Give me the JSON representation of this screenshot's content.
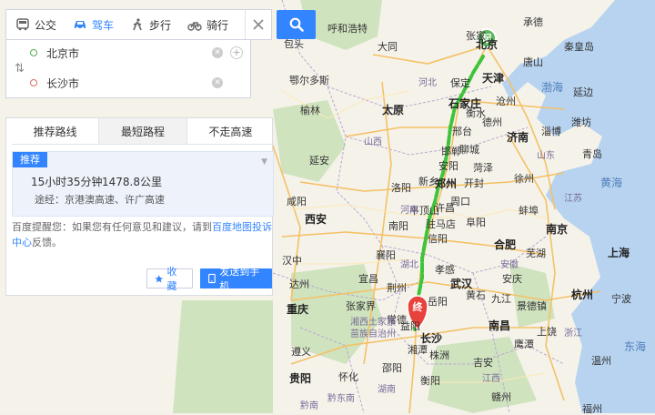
{
  "mode_tabs": [
    {
      "label": "公交",
      "icon": "bus-icon"
    },
    {
      "label": "驾车",
      "icon": "car-icon"
    },
    {
      "label": "步行",
      "icon": "walk-icon"
    },
    {
      "label": "骑行",
      "icon": "bike-icon"
    }
  ],
  "active_mode": "驾车",
  "route": {
    "origin": "北京市",
    "destination": "长沙市"
  },
  "strategy_tabs": [
    "推荐路线",
    "最短路程",
    "不走高速"
  ],
  "active_strategy": "最短路程",
  "plan": {
    "badge": "推荐",
    "duration": "15小时35分钟",
    "distance": "1478.8公里",
    "via": "途经：京港澳高速、许广高速"
  },
  "tip": {
    "prefix": "百度提醒您：如果您有任何意见和建议，请到",
    "link": "百度地图投诉中心",
    "suffix": "反馈。"
  },
  "actions": {
    "favorite": "收藏",
    "send": "发送到手机"
  },
  "markers": {
    "start": "起",
    "end": "终"
  },
  "colors": {
    "accent": "#3385ff",
    "route": "#3ec43a",
    "annotation": "#e0151b"
  },
  "map_labels": {
    "beijing": "北京",
    "zhangjiakou": "张家",
    "chengde": "承德",
    "tianjin": "天津",
    "tangshan": "唐山",
    "qinhuangdao": "秦皇岛",
    "bohai": "渤海",
    "shijiazhuang": "石家庄",
    "taiyuan": "太原",
    "jinan": "济南",
    "zibo": "淄博",
    "weifang": "潍坊",
    "qingdao": "青岛",
    "dezhou": "德州",
    "handan": "邯郸",
    "xingtai": "邢台",
    "anyang": "安阳",
    "xinxiang": "新乡",
    "zhengzhou": "郑州",
    "kaifeng": "开封",
    "luoyang": "洛阳",
    "pingdingshan": "平顶山",
    "xuchang": "许昌",
    "nanyang": "南阳",
    "xinyang": "信阳",
    "hefei": "合肥",
    "nanjing": "南京",
    "xuzhou": "徐州",
    "huanghai": "黄海",
    "wuhan": "武汉",
    "xiaogan": "孝感",
    "yichang": "宜昌",
    "changde": "常德",
    "changsha": "长沙",
    "xiangtan": "湘潭",
    "yueyang": "岳阳",
    "nanchang": "南昌",
    "jiujiang": "九江",
    "hangzhou": "杭州",
    "shanghai": "上海",
    "ningbo": "宁波",
    "donghai": "东海",
    "chongqing": "重庆",
    "guiyang": "贵阳",
    "zunyi": "遵义",
    "huaihua": "怀化",
    "hengyang": "衡阳",
    "ganzhou": "赣州",
    "wenzhou": "温州",
    "fuzhou": "福州",
    "xian": "西安",
    "baoding": "保定",
    "cangzhou": "沧州",
    "hengshui": "衡水",
    "liaocheng": "聊城",
    "heze": "菏泽",
    "bengbu": "蚌埠",
    "fuyang": "阜阳",
    "zhoukou": "周口",
    "zhumadian": "驻马店",
    "xiangyang": "襄阳",
    "jingzhou": "荆州",
    "huangshi": "黄石",
    "anqing": "安庆",
    "wuhu": "芜湖",
    "jingdezhen": "景德镇",
    "shangrao": "上饶",
    "yingtan": "鹰潭",
    "jian": "吉安",
    "zhuzhou": "株洲",
    "yiyang": "益阳",
    "zhangjiajie": "张家界",
    "xiangxi": "湘西土家族",
    "xiangxi2": "苗族自治州",
    "shaoyang": "邵阳",
    "qiandongnan": "黔东南",
    "qiannan": "黔南",
    "yunnan": "湖南",
    "jiangxi": "江西",
    "zhejiang": "浙江",
    "anhui": "安徽",
    "jiangsu": "江苏",
    "hubei": "湖北",
    "henan": "河南",
    "shandong": "山东",
    "shanxi": "山西",
    "hebei": "河北",
    "datong": "大同",
    "hohhot": "呼和浩特",
    "baotou": "包头",
    "ordos": "鄂尔多斯",
    "yulin": "榆林",
    "yanan": "延安",
    "xianyang": "咸阳",
    "hanzhong": "汉中",
    "dazhou": "达州",
    "yanbian": "延边"
  }
}
